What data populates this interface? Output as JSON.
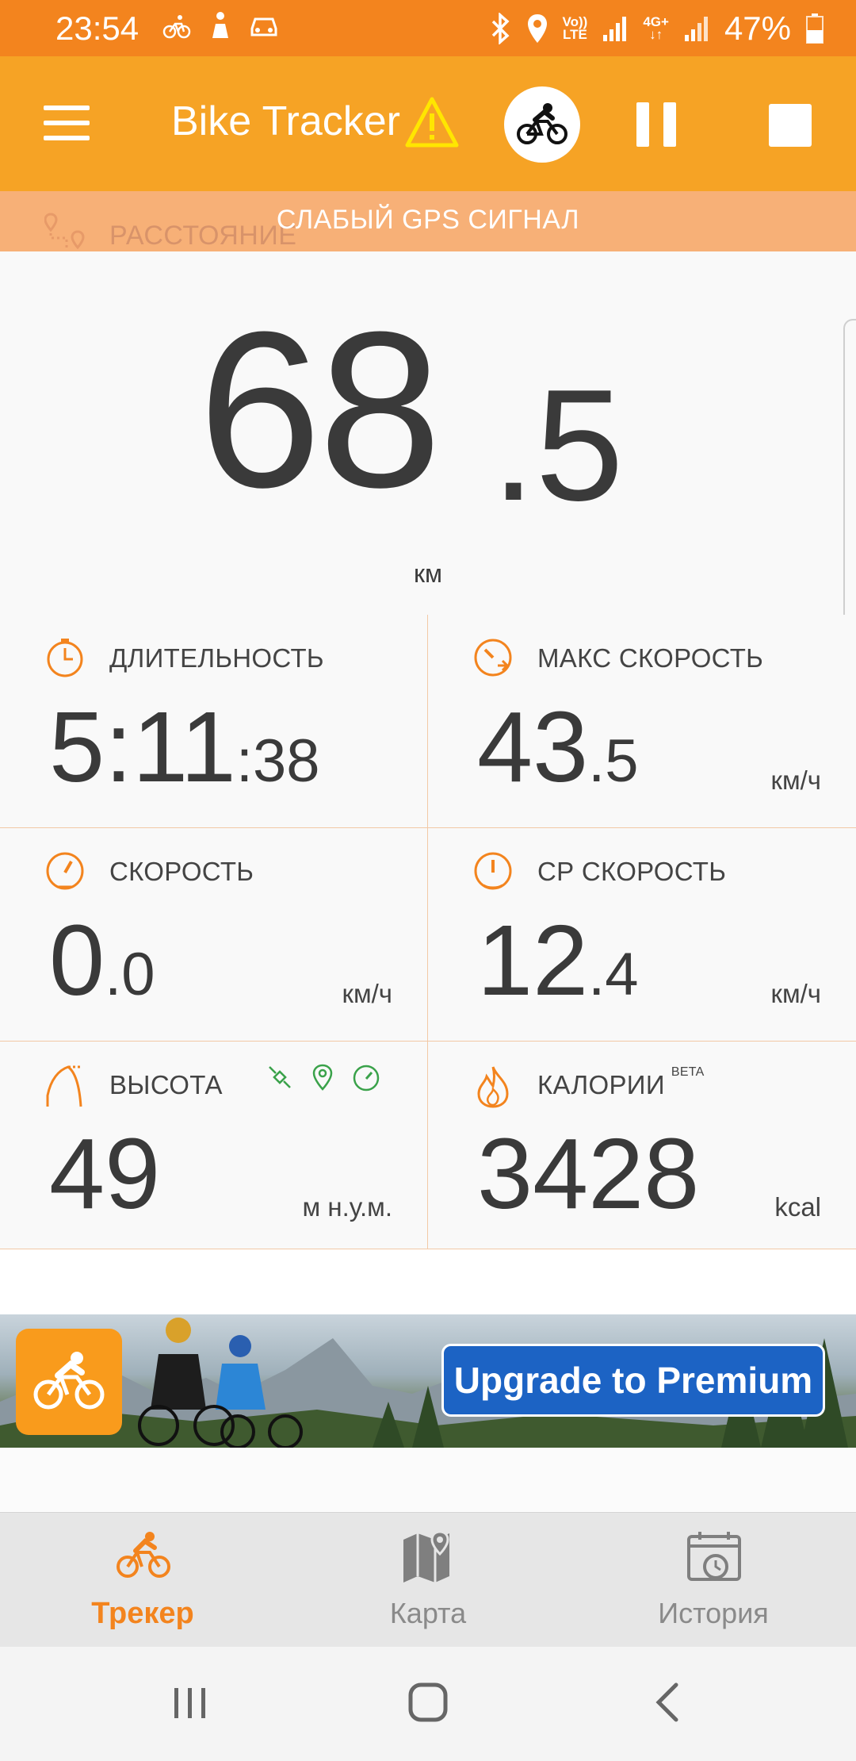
{
  "status_bar": {
    "time": "23:54",
    "network_top": "Vo))",
    "network_bottom": "LTE",
    "data_top": "4G+",
    "data_arrows": "↓↑",
    "battery": "47%"
  },
  "app_bar": {
    "title": "Bike Tracker",
    "warning_icon": "warning-triangle-icon"
  },
  "gps_banner": {
    "distance_label": "РАССТОЯНИЕ",
    "message": "СЛАБЫЙ GPS СИГНАЛ"
  },
  "distance": {
    "whole": "68",
    "decimal": ".5",
    "unit": "км"
  },
  "stats": {
    "duration": {
      "label": "ДЛИТЕЛЬНОСТЬ",
      "main": "5:11",
      "sub": ":38"
    },
    "max_speed": {
      "label": "МАКС СКОРОСТЬ",
      "main": "43",
      "sub": ".5",
      "unit": "км/ч"
    },
    "speed": {
      "label": "СКОРОСТЬ",
      "main": "0",
      "sub": ".0",
      "unit": "км/ч"
    },
    "avg_speed": {
      "label": "СР СКОРОСТЬ",
      "main": "12",
      "sub": ".4",
      "unit": "км/ч"
    },
    "altitude": {
      "label": "ВЫСОТА",
      "main": "49",
      "unit": "м н.у.м."
    },
    "calories": {
      "label": "КАЛОРИИ",
      "beta": "BETA",
      "main": "3428",
      "unit": "kcal"
    }
  },
  "ad": {
    "button_label": "Upgrade to Premium"
  },
  "bottom_nav": {
    "tracker": "Трекер",
    "map": "Карта",
    "history": "История"
  },
  "colors": {
    "status_bar": "#f3841e",
    "app_bar": "#f6a325",
    "accent": "#f3841e",
    "premium_button": "#1c63c4"
  }
}
